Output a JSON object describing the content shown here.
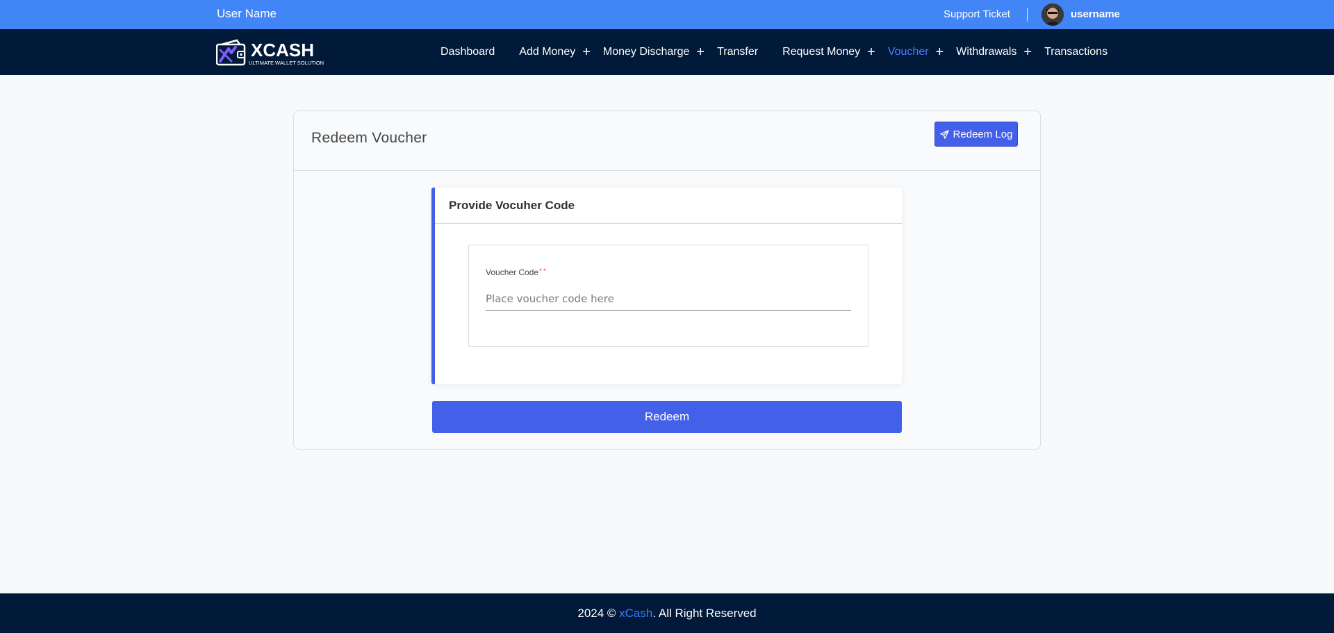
{
  "topbar": {
    "user_name_label": "User Name",
    "support_label": "Support Ticket",
    "username": "username"
  },
  "brand": {
    "logo_text": "XCASH",
    "logo_tagline": "ULTIMATE WALLET SOLUTION"
  },
  "nav": {
    "items": [
      {
        "label": "Dashboard",
        "has_submenu": false
      },
      {
        "label": "Add Money",
        "has_submenu": true
      },
      {
        "label": "Money Discharge",
        "has_submenu": true
      },
      {
        "label": "Transfer",
        "has_submenu": false
      },
      {
        "label": "Request Money",
        "has_submenu": true
      },
      {
        "label": "Voucher",
        "has_submenu": true,
        "active": true
      },
      {
        "label": "Withdrawals",
        "has_submenu": true
      },
      {
        "label": "Transactions",
        "has_submenu": false
      }
    ],
    "plus_glyph": "+"
  },
  "page": {
    "title": "Redeem Voucher",
    "redeem_log_label": "Redeem Log"
  },
  "form": {
    "card_title": "Provide Vocuher Code",
    "field_label": "Voucher Code",
    "required_marks": "* *",
    "placeholder": "Place voucher code here",
    "value": "",
    "submit_label": "Redeem"
  },
  "footer": {
    "prefix": "2024 © ",
    "brand": "xCash",
    "suffix": ". All Right Reserved"
  },
  "colors": {
    "topbar": "#4285f7",
    "navbar": "#021a3a",
    "primary": "#4360e8",
    "active_nav": "#4f7cff"
  }
}
